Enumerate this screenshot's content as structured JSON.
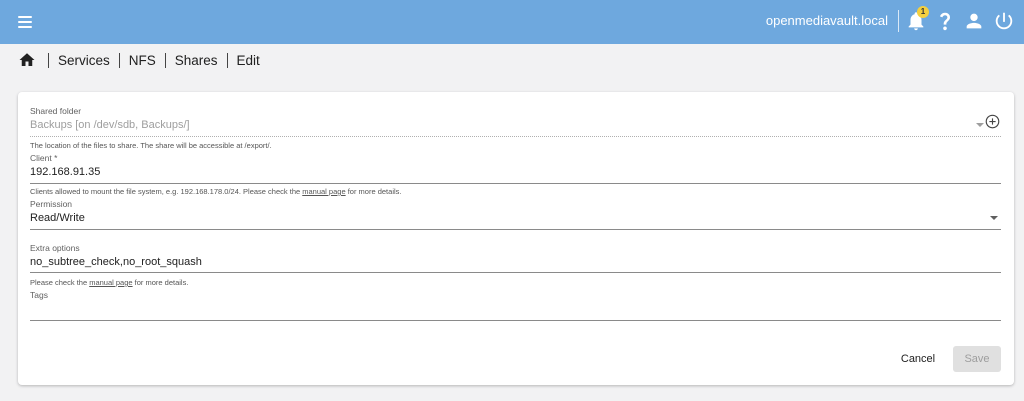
{
  "topbar": {
    "hostname": "openmediavault.local",
    "notification_count": "1",
    "icons": [
      "menu-icon",
      "bell-icon",
      "help-icon",
      "user-icon",
      "power-icon"
    ]
  },
  "breadcrumb": {
    "home_icon": "home-icon",
    "items": [
      "Services",
      "NFS",
      "Shares",
      "Edit"
    ]
  },
  "form": {
    "shared_folder": {
      "label": "Shared folder",
      "value": "Backups [on /dev/sdb, Backups/]",
      "hint": "The location of the files to share. The share will be accessible at /export/."
    },
    "client": {
      "label": "Client *",
      "value": "192.168.91.35",
      "hint_prefix": "Clients allowed to mount the file system, e.g. 192.168.178.0/24. Please check the ",
      "hint_link": "manual page",
      "hint_suffix": " for more details."
    },
    "permission": {
      "label": "Permission",
      "value": "Read/Write"
    },
    "extra_options": {
      "label": "Extra options",
      "value": "no_subtree_check,no_root_squash",
      "hint_prefix": "Please check the ",
      "hint_link": "manual page",
      "hint_suffix": " for more details."
    },
    "tags": {
      "label": "Tags",
      "value": ""
    }
  },
  "actions": {
    "cancel_label": "Cancel",
    "save_label": "Save"
  },
  "colors": {
    "topbar": "#6ea8de",
    "badge": "#f4d03f",
    "page_background": "#f2f2f3"
  }
}
